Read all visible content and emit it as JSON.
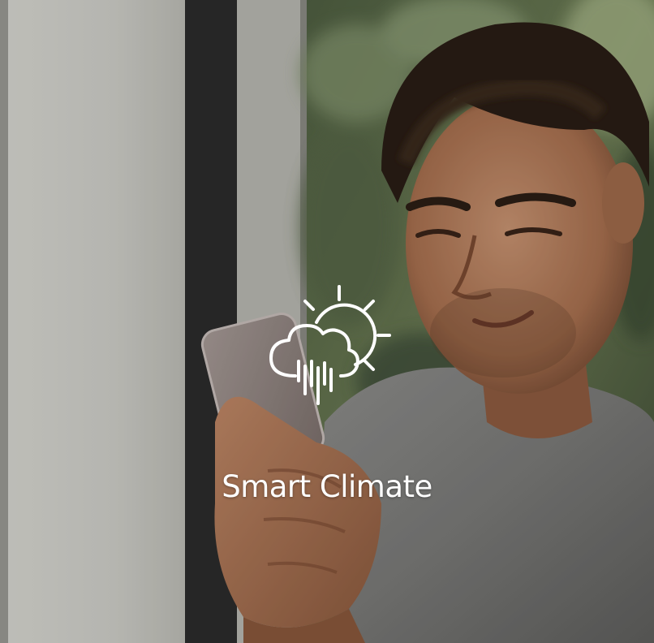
{
  "tile": {
    "title": "Smart Climate",
    "icon": "weather-sun-cloud-rain-icon",
    "text_color": "#ffffff"
  }
}
